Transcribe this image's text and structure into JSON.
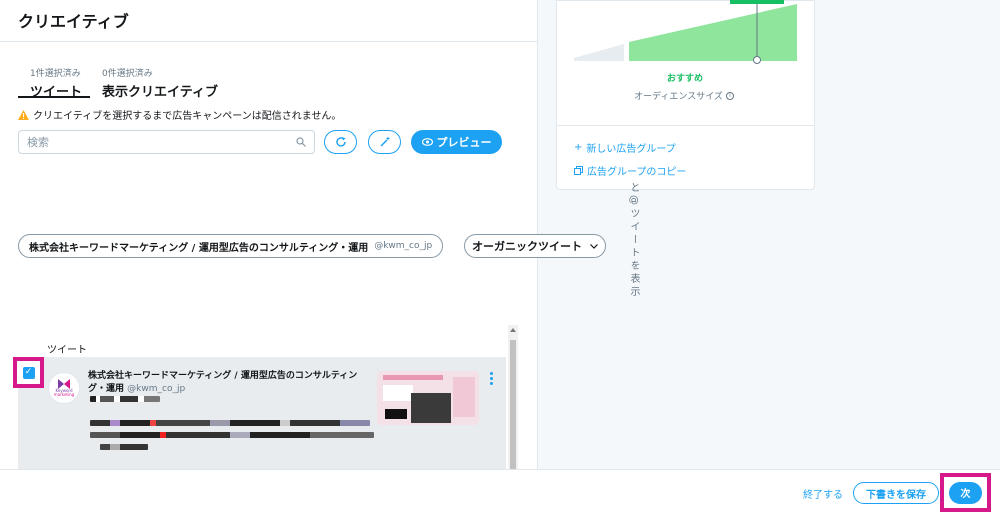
{
  "section": {
    "title": "クリエイティブ"
  },
  "tabs": [
    {
      "count": "1件選択済み",
      "label": "ツイート"
    },
    {
      "count": "0件選択済み",
      "label": "表示クリエイティブ"
    }
  ],
  "warning": "クリエイティブを選択するまで広告キャンペーンは配信されません。",
  "search": {
    "placeholder": "検索"
  },
  "preview_label": "プレビュー",
  "account_filter": {
    "name": "株式会社キーワードマーケティング / 運用型広告のコンサルティング・運用",
    "handle": "@kwm_co_jp"
  },
  "organic_filter": {
    "label": "オーガニックツイート"
  },
  "tweet_list": {
    "header": "ツイート",
    "items": [
      {
        "author": "株式会社キーワードマーケティング / 運用型広告のコンサルティング・運用",
        "handle": "@kwm_co_jp",
        "checked": true
      }
    ]
  },
  "avatar": {
    "line1": "Keyword",
    "line2": "marketing"
  },
  "audience": {
    "recommend": "おすすめ",
    "size_label": "オーディエンスサイズ",
    "new_group": "新しい広告グループ",
    "copy_group": "広告グループのコピー"
  },
  "vertical_text": "と@ツイートを表示",
  "footer": {
    "end": "終了する",
    "save_draft": "下書きを保存",
    "next": "次"
  },
  "colors": {
    "accent": "#1da1f2",
    "highlight": "#d6198a",
    "gauge_green": "#8ee59b",
    "gauge_line": "#17bf63"
  }
}
